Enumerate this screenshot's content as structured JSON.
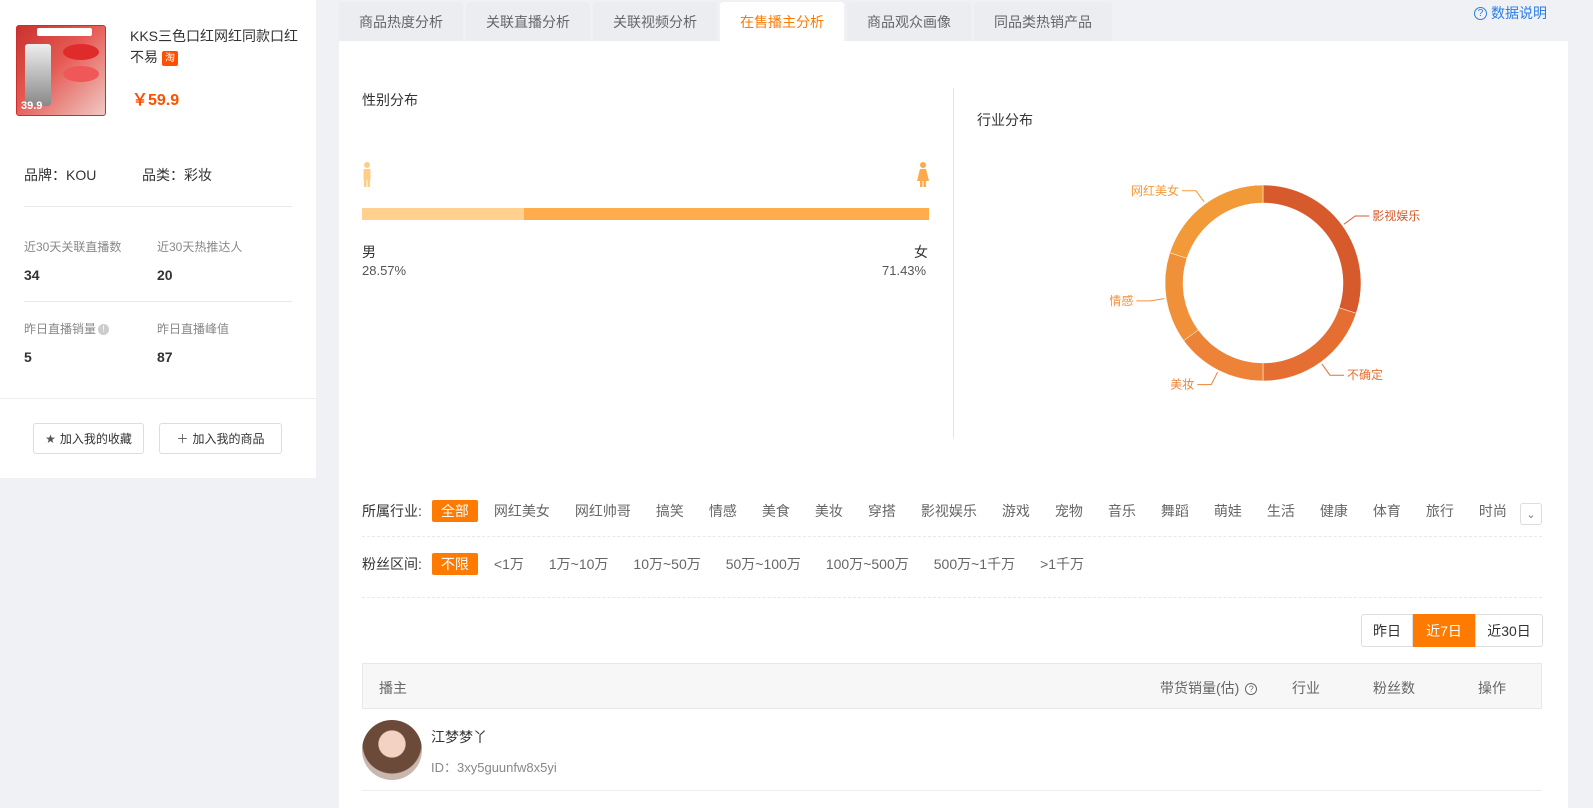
{
  "product": {
    "title": "KKS三色口红网红同款口红不易",
    "platform_tag": "淘",
    "price": "￥59.9",
    "image_price": "39.9",
    "brand": "品牌：KOU",
    "category": "品类：彩妆"
  },
  "stats": [
    {
      "label": "近30天关联直播数",
      "value": "34"
    },
    {
      "label": "近30天热推达人",
      "value": "20"
    },
    {
      "label": "昨日直播销量",
      "value": "5"
    },
    {
      "label": "昨日直播峰值",
      "value": "87"
    }
  ],
  "actions": {
    "favorite": "加入我的收藏",
    "add_goods": "加入我的商品"
  },
  "tabs": [
    {
      "label": "商品热度分析",
      "active": false
    },
    {
      "label": "关联直播分析",
      "active": false
    },
    {
      "label": "关联视频分析",
      "active": false
    },
    {
      "label": "在售播主分析",
      "active": true
    },
    {
      "label": "商品观众画像",
      "active": false
    },
    {
      "label": "同品类热销产品",
      "active": false
    }
  ],
  "help": "数据说明",
  "gender": {
    "title": "性别分布",
    "male_label": "男",
    "female_label": "女",
    "male_pct": "28.57%",
    "female_pct": "71.43%",
    "male_fraction": 0.2857,
    "female_fraction": 0.7143
  },
  "industry": {
    "title": "行业分布",
    "segments": [
      {
        "name": "影视娱乐",
        "value": 30,
        "color": "#d65a2b"
      },
      {
        "name": "不确定",
        "value": 20,
        "color": "#e56f32"
      },
      {
        "name": "美妆",
        "value": 15,
        "color": "#ec8338"
      },
      {
        "name": "情感",
        "value": 15,
        "color": "#f0913a"
      },
      {
        "name": "网红美女",
        "value": 20,
        "color": "#f39a38"
      }
    ]
  },
  "filters": {
    "industry_label": "所属行业:",
    "industries": [
      "全部",
      "网红美女",
      "网红帅哥",
      "搞笑",
      "情感",
      "美食",
      "美妆",
      "穿搭",
      "影视娱乐",
      "游戏",
      "宠物",
      "音乐",
      "舞蹈",
      "萌娃",
      "生活",
      "健康",
      "体育",
      "旅行",
      "时尚"
    ],
    "fans_label": "粉丝区间:",
    "fans": [
      "不限",
      "<1万",
      "1万~10万",
      "10万~50万",
      "50万~100万",
      "100万~500万",
      "500万~1千万",
      ">1千万"
    ]
  },
  "periods": [
    {
      "label": "昨日",
      "active": false
    },
    {
      "label": "近7日",
      "active": true
    },
    {
      "label": "近30日",
      "active": false
    }
  ],
  "table": {
    "headers": {
      "anchor": "播主",
      "sales": "带货销量(估)",
      "industry": "行业",
      "fans": "粉丝数",
      "ops": "操作"
    },
    "rows": [
      {
        "name": "江梦梦丫",
        "id": "ID：3xy5guunfw8x5yi"
      }
    ]
  }
}
